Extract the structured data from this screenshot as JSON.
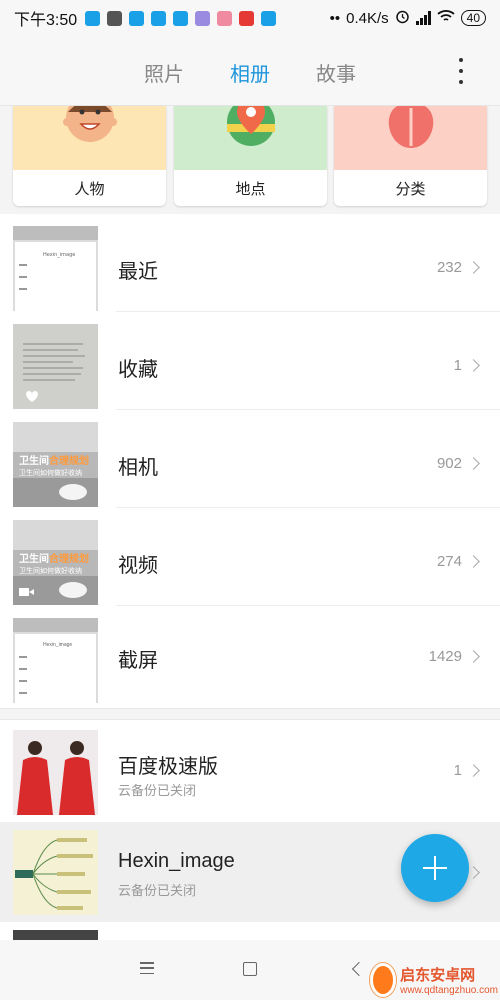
{
  "status_bar": {
    "time": "下午3:50",
    "network_speed": "0.4K/s",
    "battery": "40"
  },
  "tabs": [
    {
      "label": "照片",
      "active": false
    },
    {
      "label": "相册",
      "active": true
    },
    {
      "label": "故事",
      "active": false
    }
  ],
  "categories": [
    {
      "label": "人物",
      "color": "#fde6b3"
    },
    {
      "label": "地点",
      "color": "#cfeccc"
    },
    {
      "label": "分类",
      "color": "#fdd0c6"
    }
  ],
  "albums": [
    {
      "title": "最近",
      "count": "232",
      "badge": "clock-icon"
    },
    {
      "title": "收藏",
      "count": "1",
      "badge": "heart-icon"
    },
    {
      "title": "相机",
      "count": "902"
    },
    {
      "title": "视频",
      "count": "274",
      "badge": "video-icon"
    },
    {
      "title": "截屏",
      "count": "1429"
    }
  ],
  "cloud_albums": [
    {
      "title": "百度极速版",
      "subtitle": "云备份已关闭",
      "count": "1"
    },
    {
      "title": "Hexin_image",
      "subtitle": "云备份已关闭"
    }
  ],
  "thumb_text": {
    "camera_line1_a": "卫生间",
    "camera_line1_b": "合理规划",
    "camera_line2": "卫生间如何做好收纳"
  },
  "screenshot_thumb_title": "Hexin_image",
  "watermark": {
    "title": "启东安卓网",
    "url": "www.qdtangzhuo.com"
  },
  "accent_color": "#1e96dc"
}
